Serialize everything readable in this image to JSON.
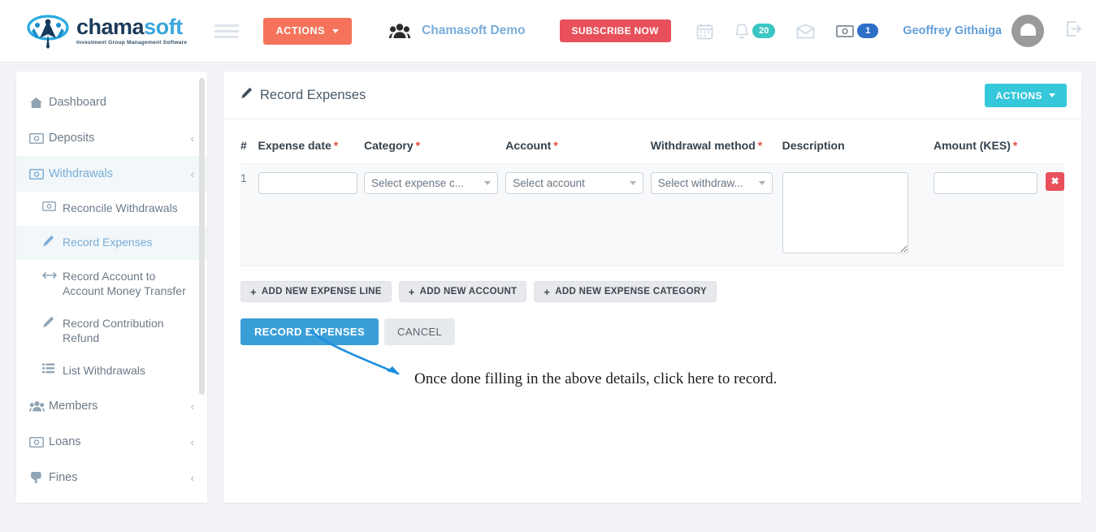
{
  "header": {
    "logo": {
      "word_primary": "chama",
      "word_secondary": "soft",
      "tagline": "Investment Group Management Software"
    },
    "menu_toggle_name": "hamburger-menu",
    "actions_button": "ACTIONS",
    "group_name": "Chamasoft Demo",
    "subscribe_button": "SUBSCRIBE NOW",
    "calendar_icon": "calendar-icon",
    "notifications": {
      "icon": "bell-icon",
      "count": "20",
      "color": "#3bc6c3"
    },
    "messages_icon": "envelope-icon",
    "payments": {
      "icon": "money-icon",
      "count": "1",
      "color": "#2e6fc7"
    },
    "user_name": "Geoffrey Githaiga",
    "avatar": "user-avatar",
    "logout_icon": "logout-icon"
  },
  "sidebar": {
    "items": [
      {
        "label": "Dashboard",
        "icon": "home-icon",
        "expandable": false,
        "active": false
      },
      {
        "label": "Deposits",
        "icon": "money-icon",
        "expandable": true,
        "active": false
      },
      {
        "label": "Withdrawals",
        "icon": "money-icon",
        "expandable": true,
        "active": true
      }
    ],
    "sub_items": [
      {
        "label": "Reconcile Withdrawals",
        "icon": "money-icon",
        "active": false
      },
      {
        "label": "Record Expenses",
        "icon": "pencil-icon",
        "active": true
      },
      {
        "label": "Record Account to Account Money Transfer",
        "icon": "transfer-icon",
        "active": false
      },
      {
        "label": "Record Contribution Refund",
        "icon": "pencil-icon",
        "active": false
      },
      {
        "label": "List Withdrawals",
        "icon": "list-icon",
        "active": false
      }
    ],
    "items_after": [
      {
        "label": "Members",
        "icon": "people-icon",
        "expandable": true,
        "active": false
      },
      {
        "label": "Loans",
        "icon": "money-icon",
        "expandable": true,
        "active": false
      },
      {
        "label": "Fines",
        "icon": "thumbs-down-icon",
        "expandable": true,
        "active": false
      }
    ],
    "chevron": "‹"
  },
  "main": {
    "page_title": "Record Expenses",
    "page_title_icon": "pencil-icon",
    "actions_button": "ACTIONS",
    "table": {
      "columns": [
        {
          "label": "#",
          "required": false
        },
        {
          "label": "Expense date",
          "required": true
        },
        {
          "label": "Category",
          "required": true
        },
        {
          "label": "Account",
          "required": true
        },
        {
          "label": "Withdrawal method",
          "required": true
        },
        {
          "label": "Description",
          "required": false
        },
        {
          "label": "Amount (KES)",
          "required": true
        }
      ],
      "required_marker": "*",
      "rows": [
        {
          "number": "1",
          "expense_date": "",
          "expense_date_placeholder": "",
          "category": "Select expense c...",
          "account": "Select account",
          "withdrawal_method": "Select withdraw...",
          "description": "",
          "amount": "",
          "delete_label": "✖"
        }
      ]
    },
    "add_buttons": [
      {
        "label": "ADD NEW EXPENSE LINE",
        "icon": "plus-icon"
      },
      {
        "label": "ADD NEW ACCOUNT",
        "icon": "plus-icon"
      },
      {
        "label": "ADD NEW EXPENSE CATEGORY",
        "icon": "plus-icon"
      }
    ],
    "submit_button": "RECORD EXPENSES",
    "cancel_button": "CANCEL"
  },
  "annotation": {
    "text": "Once done filling in the above details, click here to record.",
    "arrow_color": "#1d8fe0"
  }
}
